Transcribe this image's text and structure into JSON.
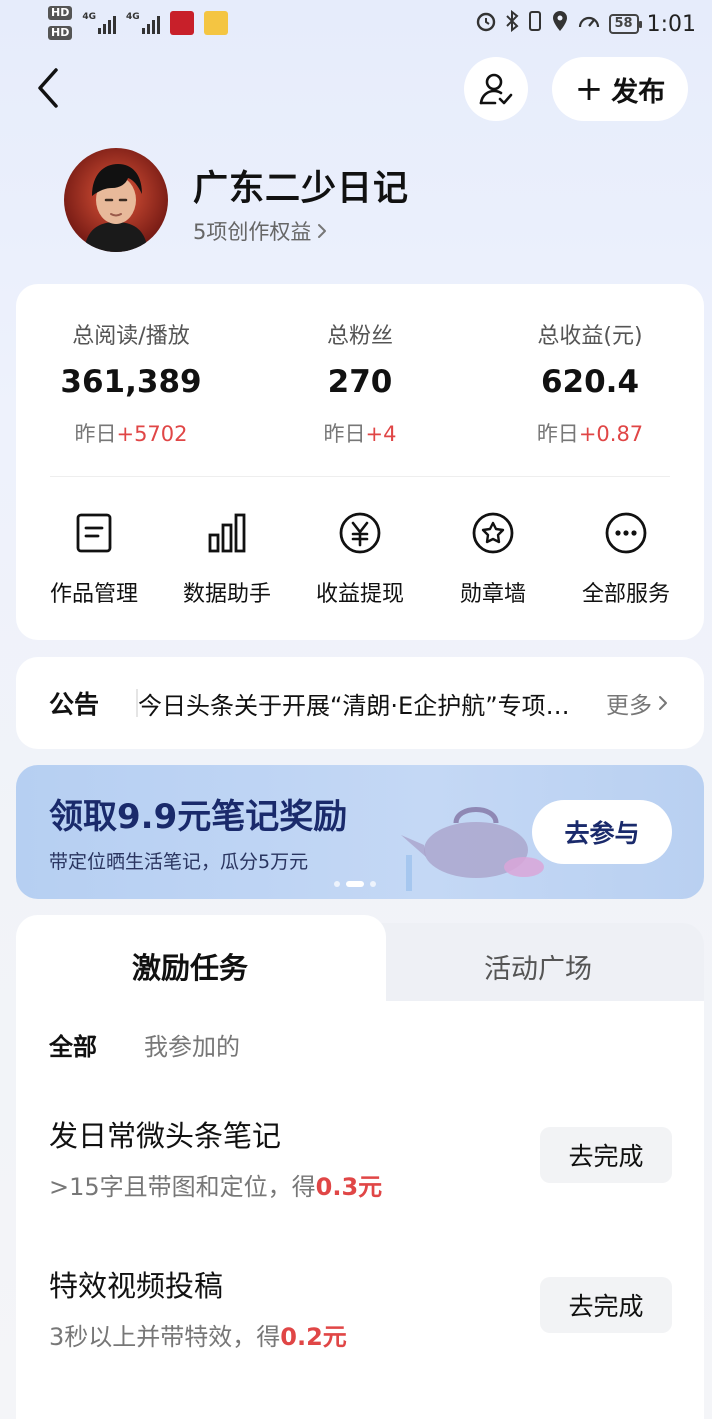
{
  "status_bar": {
    "hd1": "HD",
    "hd2": "HD",
    "net1": "4G",
    "net2": "4G",
    "battery": "58",
    "time": "1:01"
  },
  "header": {
    "publish_label": "发布"
  },
  "profile": {
    "name": "广东二少日记",
    "rights": "5项创作权益"
  },
  "stats": [
    {
      "label": "总阅读/播放",
      "value": "361,389",
      "delta_prefix": "昨日",
      "delta": "+5702"
    },
    {
      "label": "总粉丝",
      "value": "270",
      "delta_prefix": "昨日",
      "delta": "+4"
    },
    {
      "label": "总收益(元)",
      "value": "620.4",
      "delta_prefix": "昨日",
      "delta": "+0.87"
    }
  ],
  "services": [
    {
      "label": "作品管理",
      "icon": "document-icon"
    },
    {
      "label": "数据助手",
      "icon": "bar-chart-icon"
    },
    {
      "label": "收益提现",
      "icon": "yuan-icon"
    },
    {
      "label": "勋章墙",
      "icon": "badge-icon"
    },
    {
      "label": "全部服务",
      "icon": "more-icon"
    }
  ],
  "notice": {
    "tag": "公告",
    "message": "今日头条关于开展“清朗·E企护航”专项行动的公告",
    "more": "更多"
  },
  "banner": {
    "title": "领取9.9元笔记奖励",
    "subtitle": "带定位晒生活笔记，瓜分5万元",
    "button": "去参与",
    "slides": 3,
    "active_slide": 2
  },
  "tasks": {
    "tabs": [
      "激励任务",
      "活动广场"
    ],
    "active_tab": "激励任务",
    "filters": [
      "全部",
      "我参加的"
    ],
    "active_filter": "全部",
    "items": [
      {
        "title": "发日常微头条笔记",
        "desc": ">15字且带图和定位，得",
        "reward": "0.3元",
        "button": "去完成"
      },
      {
        "title": "特效视频投稿",
        "desc": "3秒以上并带特效，得",
        "reward": "0.2元",
        "button": "去完成"
      }
    ]
  },
  "colors": {
    "accent_red": "#e04646",
    "banner_title": "#1a2a6b",
    "card_bg": "#ffffff"
  }
}
